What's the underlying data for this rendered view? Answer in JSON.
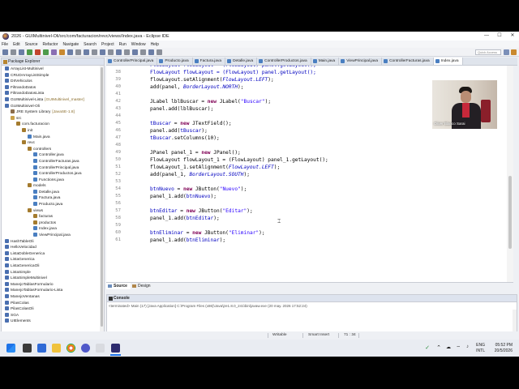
{
  "window": {
    "title": "2026 - GUIMultinivel-Oli/src/com/facturacion/revc/views/Index.java - Eclipse IDE",
    "minimize": "—",
    "maximize": "☐",
    "close": "✕"
  },
  "menu": [
    "File",
    "Edit",
    "Source",
    "Refactor",
    "Navigate",
    "Search",
    "Project",
    "Run",
    "Window",
    "Help"
  ],
  "toolbar": {
    "quick_access_placeholder": "Quick Access"
  },
  "package_explorer": {
    "title": "Package Explorer",
    "rows": [
      {
        "label": "ArrayList-Multinivel",
        "indent": 1,
        "icon": "project-icon"
      },
      {
        "label": "CRUDArrayListSimple",
        "indent": 1,
        "icon": "project-icon"
      },
      {
        "label": "DIIVehiculos",
        "indent": 1,
        "icon": "project-icon"
      },
      {
        "label": "FiltrandoDatos",
        "indent": 1,
        "icon": "project-icon"
      },
      {
        "label": "FiltrandoDatosLista",
        "indent": 1,
        "icon": "project-icon"
      },
      {
        "label": "GUIMultinivel-Lista",
        "decoration": "[GUIMultinivel_master]",
        "indent": 1,
        "icon": "project-icon"
      },
      {
        "label": "GUIMultinivel-Oli",
        "indent": 1,
        "icon": "project-icon"
      },
      {
        "label": "JRE System Library",
        "decoration": "[JavaSE-1.8]",
        "indent": 2,
        "icon": "library-icon"
      },
      {
        "label": "src",
        "indent": 2,
        "icon": "folder-icon"
      },
      {
        "label": "com.facturacion",
        "indent": 3,
        "icon": "package-icon"
      },
      {
        "label": "init",
        "indent": 4,
        "icon": "package-icon"
      },
      {
        "label": "Main.java",
        "indent": 5,
        "icon": "java-file-icon"
      },
      {
        "label": "revc",
        "indent": 4,
        "icon": "package-icon"
      },
      {
        "label": "controllers",
        "indent": 5,
        "icon": "package-icon"
      },
      {
        "label": "Controller.java",
        "indent": 6,
        "icon": "java-file-icon"
      },
      {
        "label": "ControllerFacturas.java",
        "indent": 6,
        "icon": "java-file-icon"
      },
      {
        "label": "ControllerPrincipal.java",
        "indent": 6,
        "icon": "java-file-icon"
      },
      {
        "label": "ControllerProductos.java",
        "indent": 6,
        "icon": "java-file-icon"
      },
      {
        "label": "Functions.java",
        "indent": 6,
        "icon": "java-file-icon"
      },
      {
        "label": "models",
        "indent": 5,
        "icon": "package-icon"
      },
      {
        "label": "Detalle.java",
        "indent": 6,
        "icon": "java-file-icon"
      },
      {
        "label": "Factura.java",
        "indent": 6,
        "icon": "java-file-icon"
      },
      {
        "label": "Producto.java",
        "indent": 6,
        "icon": "java-file-icon"
      },
      {
        "label": "views",
        "indent": 5,
        "icon": "package-icon"
      },
      {
        "label": "facturas",
        "indent": 6,
        "icon": "package-icon"
      },
      {
        "label": "productos",
        "indent": 6,
        "icon": "package-icon"
      },
      {
        "label": "Index.java",
        "indent": 6,
        "icon": "java-file-icon"
      },
      {
        "label": "ViewPrincipal.java",
        "indent": 6,
        "icon": "java-file-icon"
      },
      {
        "label": "HashTableOli",
        "indent": 1,
        "icon": "project-icon"
      },
      {
        "label": "HelloVelocidad",
        "indent": 1,
        "icon": "project-icon"
      },
      {
        "label": "ListaDobleGenerica",
        "indent": 1,
        "icon": "project-icon"
      },
      {
        "label": "ListaGenerica",
        "indent": 1,
        "icon": "project-icon"
      },
      {
        "label": "ListaGenericaOli",
        "indent": 1,
        "icon": "project-icon"
      },
      {
        "label": "ListaSimple",
        "indent": 1,
        "icon": "project-icon"
      },
      {
        "label": "ListaSimpleMultinivel",
        "indent": 1,
        "icon": "project-icon"
      },
      {
        "label": "ManejoTablasFormulario",
        "indent": 1,
        "icon": "project-icon"
      },
      {
        "label": "ManejoTablasFormulario-Lista",
        "indent": 1,
        "icon": "project-icon"
      },
      {
        "label": "ManejoVentanas",
        "indent": 1,
        "icon": "project-icon"
      },
      {
        "label": "PilasColas",
        "indent": 1,
        "icon": "project-icon"
      },
      {
        "label": "PilasColasOli",
        "indent": 1,
        "icon": "project-icon"
      },
      {
        "label": "SGA",
        "indent": 1,
        "icon": "project-icon"
      },
      {
        "label": "UIElements",
        "indent": 1,
        "icon": "project-icon"
      }
    ]
  },
  "editor_tabs": [
    {
      "label": "ControllerPrincipal.java",
      "active": false
    },
    {
      "label": "Producto.java",
      "active": false
    },
    {
      "label": "Factura.java",
      "active": false
    },
    {
      "label": "Detalle.java",
      "active": false
    },
    {
      "label": "ControllerProductos.java",
      "active": false
    },
    {
      "label": "Main.java",
      "active": false
    },
    {
      "label": "ViewPrincipal.java",
      "active": false
    },
    {
      "label": "ControllerFacturas.java",
      "active": false
    },
    {
      "label": "Index.java",
      "active": true
    }
  ],
  "code_lines": [
    {
      "n": "37",
      "t": [
        [
          "tk-field",
          "FlowLayout flowLayout = (FlowLayout) panel.getLayout();"
        ]
      ]
    },
    {
      "n": "38",
      "t": [
        [
          "tk-field",
          "FlowLayout flowLayout = (FlowLayout) panel.getLayout();"
        ]
      ]
    },
    {
      "n": "39",
      "t": [
        [
          "",
          "flowLayout.setAlignment("
        ],
        [
          "tk-static",
          "FlowLayout.LEFT"
        ],
        [
          "",
          ");"
        ]
      ]
    },
    {
      "n": "40",
      "t": [
        [
          "",
          "add(panel, "
        ],
        [
          "tk-static",
          "BorderLayout.NORTH"
        ],
        [
          "",
          ");"
        ]
      ]
    },
    {
      "n": "41",
      "t": [
        [
          "",
          ""
        ]
      ]
    },
    {
      "n": "42",
      "t": [
        [
          "",
          "JLabel lblBuscar = "
        ],
        [
          "tk-kw",
          "new"
        ],
        [
          "",
          " JLabel("
        ],
        [
          "tk-str",
          "\"Buscar\""
        ],
        [
          "",
          ");"
        ]
      ]
    },
    {
      "n": "43",
      "t": [
        [
          "",
          "panel.add(lblBuscar);"
        ]
      ]
    },
    {
      "n": "44",
      "t": [
        [
          "",
          ""
        ]
      ]
    },
    {
      "n": "45",
      "t": [
        [
          "tk-field",
          "tBuscar"
        ],
        [
          "",
          " = "
        ],
        [
          "tk-kw",
          "new"
        ],
        [
          "",
          " JTextField();"
        ]
      ]
    },
    {
      "n": "46",
      "t": [
        [
          "",
          "panel.add("
        ],
        [
          "tk-field",
          "tBuscar"
        ],
        [
          "",
          ");"
        ]
      ]
    },
    {
      "n": "47",
      "t": [
        [
          "tk-field",
          "tBuscar"
        ],
        [
          "",
          ".setColumns(10);"
        ]
      ]
    },
    {
      "n": "48",
      "t": [
        [
          "",
          ""
        ]
      ]
    },
    {
      "n": "49",
      "t": [
        [
          "",
          "JPanel panel_1 = "
        ],
        [
          "tk-kw",
          "new"
        ],
        [
          "",
          " JPanel();"
        ]
      ]
    },
    {
      "n": "50",
      "t": [
        [
          "",
          "FlowLayout flowLayout_1 = (FlowLayout) panel_1.getLayout();"
        ]
      ]
    },
    {
      "n": "51",
      "t": [
        [
          "",
          "flowLayout_1.setAlignment("
        ],
        [
          "tk-static",
          "FlowLayout.LEFT"
        ],
        [
          "",
          ");"
        ]
      ]
    },
    {
      "n": "52",
      "t": [
        [
          "",
          "add(panel_1, "
        ],
        [
          "tk-static",
          "BorderLayout.SOUTH"
        ],
        [
          "",
          ");"
        ]
      ]
    },
    {
      "n": "53",
      "t": [
        [
          "",
          ""
        ]
      ]
    },
    {
      "n": "54",
      "t": [
        [
          "tk-field",
          "btnNuevo"
        ],
        [
          "",
          " = "
        ],
        [
          "tk-kw",
          "new"
        ],
        [
          "",
          " JButton("
        ],
        [
          "tk-str",
          "\"Nuevo\""
        ],
        [
          "",
          ");"
        ]
      ]
    },
    {
      "n": "55",
      "t": [
        [
          "",
          "panel_1.add("
        ],
        [
          "tk-field",
          "btnNuevo"
        ],
        [
          "",
          ");"
        ]
      ]
    },
    {
      "n": "56",
      "t": [
        [
          "",
          ""
        ]
      ]
    },
    {
      "n": "57",
      "t": [
        [
          "tk-field",
          "btnEditar"
        ],
        [
          "",
          " = "
        ],
        [
          "tk-kw",
          "new"
        ],
        [
          "",
          " JButton("
        ],
        [
          "tk-str",
          "\"Editar\""
        ],
        [
          "",
          ");"
        ]
      ]
    },
    {
      "n": "58",
      "t": [
        [
          "",
          "panel_1.add("
        ],
        [
          "tk-field",
          "btnEditar"
        ],
        [
          "",
          ");"
        ]
      ]
    },
    {
      "n": "59",
      "t": [
        [
          "",
          ""
        ]
      ]
    },
    {
      "n": "60",
      "t": [
        [
          "tk-field",
          "btnEliminar"
        ],
        [
          "",
          " = "
        ],
        [
          "tk-kw",
          "new"
        ],
        [
          "",
          " JButton("
        ],
        [
          "tk-str",
          "\"Eliminar\""
        ],
        [
          "",
          ");"
        ]
      ]
    },
    {
      "n": "61",
      "t": [
        [
          "",
          "panel_1.add("
        ],
        [
          "tk-field",
          "btnEliminar"
        ],
        [
          "",
          ");"
        ]
      ]
    }
  ],
  "webcam": {
    "caption": "Oliver Blanco Sarai"
  },
  "source_tabs": [
    "Source",
    "Design"
  ],
  "console": {
    "title": "Console",
    "terminated_text": "<terminated> Main (17) [Java Application] C:\\Program Files (x86)\\Java\\jre1.8.0_241\\bin\\javaw.exe (20 may. 2026 17:52:24)"
  },
  "status": {
    "writable": "Writable",
    "insert_mode": "Smart Insert",
    "position": "71 : 34"
  },
  "tray": {
    "lang": "ENG",
    "kbd": "INTL",
    "time": "05:52 PM",
    "date": "20/5/2026"
  },
  "colors": {
    "keyword": "#7f0055",
    "field": "#0000c0",
    "string": "#2a00ff"
  }
}
